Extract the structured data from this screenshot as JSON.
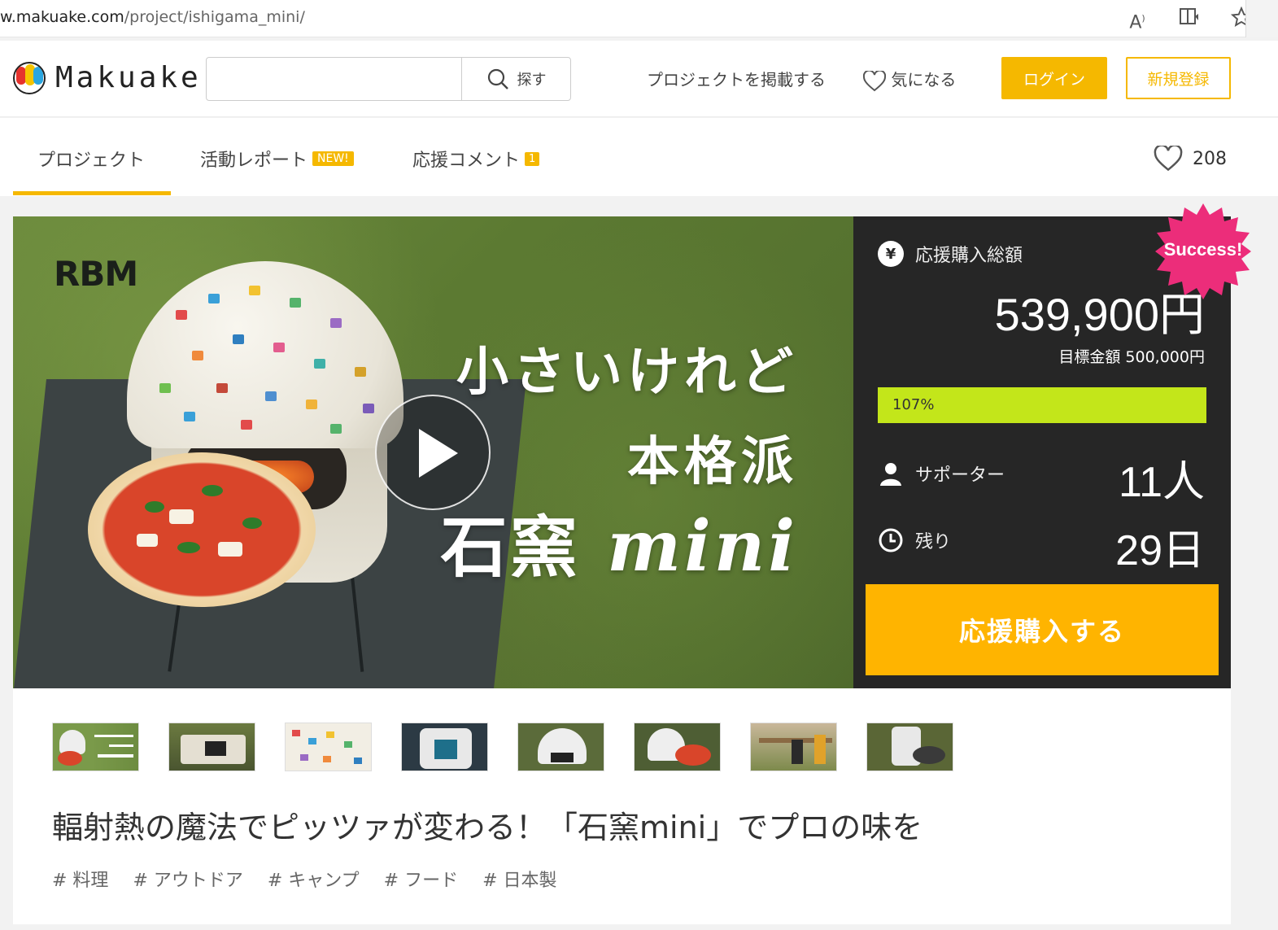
{
  "browser": {
    "url_host": "w.makuake.com",
    "url_path": "/project/ishigama_mini/"
  },
  "header": {
    "logo_text": "Makuake",
    "search_placeholder": "",
    "search_button": "探す",
    "post_project": "プロジェクトを掲載する",
    "favorites": "気になる",
    "login": "ログイン",
    "register": "新規登録"
  },
  "tabs": {
    "project": "プロジェクト",
    "report": "活動レポート",
    "report_badge": "NEW!",
    "comments": "応援コメント",
    "comments_badge": "1",
    "like_count": "208"
  },
  "hero": {
    "brand": "RBM",
    "title_line1": "小さいけれど",
    "title_line2": "本格派",
    "title_line3_jp": "石窯",
    "title_line3_en": "mini"
  },
  "panel": {
    "total_label": "応援購入総額",
    "total_icon": "¥",
    "amount": "539,900円",
    "goal": "目標金額 500,000円",
    "progress_percent": 107,
    "progress_label": "107%",
    "supporters_label": "サポーター",
    "supporters_value": "11人",
    "remaining_label": "残り",
    "remaining_value": "29日",
    "cta": "応援購入する",
    "success": "Success!"
  },
  "project": {
    "title": "輻射熱の魔法でピッツァが変わる！「石窯mini」でプロの味を",
    "tags": [
      "# 料理",
      "# アウトドア",
      "# キャンプ",
      "# フード",
      "# 日本製"
    ]
  },
  "thumbnails": [
    {
      "alt": "thumbnail-1"
    },
    {
      "alt": "thumbnail-2"
    },
    {
      "alt": "thumbnail-3"
    },
    {
      "alt": "thumbnail-4"
    },
    {
      "alt": "thumbnail-5"
    },
    {
      "alt": "thumbnail-6"
    },
    {
      "alt": "thumbnail-7"
    },
    {
      "alt": "thumbnail-8"
    }
  ],
  "colors": {
    "brand_yellow": "#f5b800",
    "cta_orange": "#ffb400",
    "progress_green": "#c3e61a",
    "panel_dark": "#262626",
    "success_pink": "#ec2d7a"
  }
}
